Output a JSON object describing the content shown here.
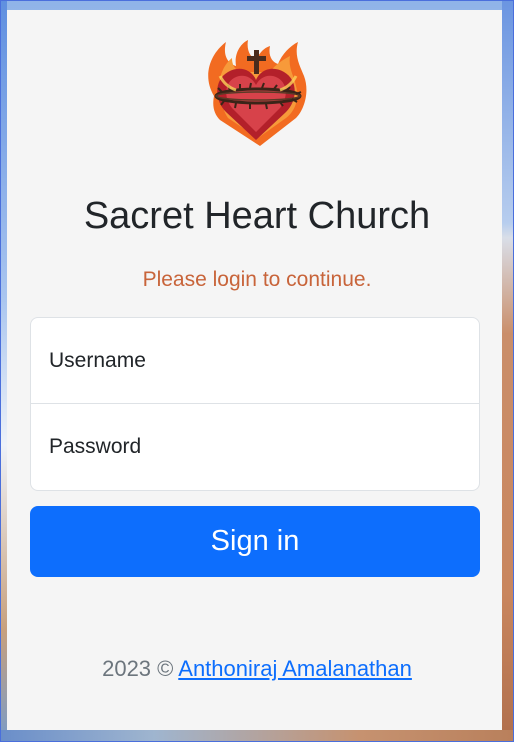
{
  "app": {
    "title": "Sacret Heart Church",
    "subtitle": "Please login to continue."
  },
  "form": {
    "username_placeholder": "Username",
    "password_placeholder": "Password",
    "signin_label": "Sign in"
  },
  "footer": {
    "prefix": "2023 ©",
    "author_link": "Anthoniraj Amalanathan"
  },
  "colors": {
    "accent": "#0d6efd",
    "subtitle": "#c8643a",
    "card": "#f5f5f5"
  },
  "icons": {
    "logo": "sacred-heart-icon"
  }
}
